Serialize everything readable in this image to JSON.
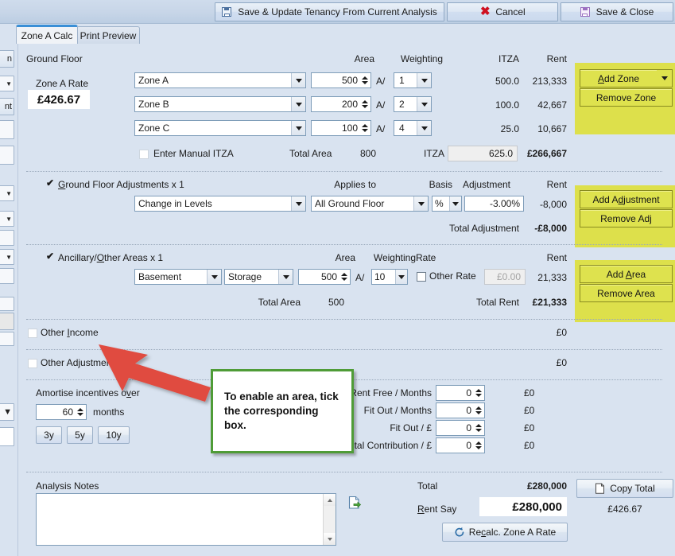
{
  "toolbar": {
    "save_update_label": "Save & Update Tenancy From Current Analysis",
    "cancel_label": "Cancel",
    "save_close_label": "Save & Close",
    "save_icon": "floppy-disk-icon",
    "cancel_icon": "red-x-icon"
  },
  "tabs": [
    {
      "label": "Zone A Calc",
      "active": true
    },
    {
      "label": "Print Preview",
      "active": false
    }
  ],
  "left_strip": {
    "stub_top_label": "n",
    "stub_mid_label": "nt"
  },
  "ground_floor": {
    "title": "Ground Floor",
    "zone_a_rate_label": "Zone A Rate",
    "zone_a_rate_value": "£426.67",
    "headers": {
      "area": "Area",
      "weighting": "Weighting",
      "itza": "ITZA",
      "rent": "Rent"
    },
    "rows": [
      {
        "zone": "Zone A",
        "area": "500",
        "weight_prefix": "A/",
        "weight": "1",
        "itza": "500.0",
        "rent": "213,333"
      },
      {
        "zone": "Zone B",
        "area": "200",
        "weight_prefix": "A/",
        "weight": "2",
        "itza": "100.0",
        "rent": "42,667"
      },
      {
        "zone": "Zone C",
        "area": "100",
        "weight_prefix": "A/",
        "weight": "4",
        "itza": "25.0",
        "rent": "10,667"
      }
    ],
    "manual_itza_label": "Enter Manual ITZA",
    "manual_itza_checked": false,
    "total_area_label": "Total Area",
    "total_area_value": "800",
    "itza_label": "ITZA",
    "itza_total": "625.0",
    "rent_total": "£266,667",
    "add_zone_label": "Add Zone",
    "remove_zone_label": "Remove Zone"
  },
  "adjustments": {
    "title": "Ground Floor Adjustments x 1",
    "checked": true,
    "headers": {
      "applies_to": "Applies to",
      "basis": "Basis",
      "adjustment": "Adjustment",
      "rent": "Rent"
    },
    "rows": [
      {
        "type": "Change in Levels",
        "applies_to": "All Ground Floor",
        "basis": "%",
        "adjustment": "-3.00%",
        "rent": "-8,000"
      }
    ],
    "total_label": "Total Adjustment",
    "total_value": "-£8,000",
    "add_label": "Add Adjustment",
    "remove_label": "Remove Adj"
  },
  "ancillary": {
    "title": "Ancillary/Other Areas x 1",
    "checked": true,
    "headers": {
      "area": "Area",
      "weighting": "Weighting",
      "rate": "Rate",
      "rent": "Rent"
    },
    "rows": [
      {
        "location": "Basement",
        "use": "Storage",
        "area": "500",
        "weight_prefix": "A/",
        "weight": "10",
        "other_rate_label": "Other Rate",
        "other_rate_checked": false,
        "rate_value": "£0.00",
        "rent": "21,333"
      }
    ],
    "total_area_label": "Total Area",
    "total_area_value": "500",
    "total_rent_label": "Total Rent",
    "total_rent_value": "£21,333",
    "add_label": "Add Area",
    "remove_label": "Remove Area"
  },
  "other_income": {
    "label": "Other Income",
    "checked": false,
    "value": "£0"
  },
  "other_adjustments": {
    "label": "Other Adjustments",
    "checked": false,
    "value": "£0"
  },
  "incentives": {
    "amortise_label": "Amortise incentives over",
    "months_value": "60",
    "months_label": "months",
    "preset_3y": "3y",
    "preset_5y": "5y",
    "preset_10y": "10y",
    "rows": [
      {
        "label": "Rent Free / Months",
        "value": "0",
        "amount": "£0"
      },
      {
        "label": "Fit Out / Months",
        "value": "0",
        "amount": "£0"
      },
      {
        "label": "Fit Out / £",
        "value": "0",
        "amount": "£0"
      },
      {
        "label": "Capital Contribution / £",
        "value": "0",
        "amount": "£0"
      }
    ]
  },
  "notes": {
    "label": "Analysis Notes",
    "value": "",
    "export_icon": "document-export-icon"
  },
  "summary": {
    "total_label": "Total",
    "total_value": "£280,000",
    "rent_say_label": "Rent Say",
    "rent_say_value": "£280,000",
    "copy_total_label": "Copy Total",
    "copy_total_icon": "clipboard-icon",
    "zone_a_rate_display": "£426.67",
    "recalc_label": "Recalc. Zone A Rate",
    "recalc_icon": "refresh-icon"
  },
  "annotation": {
    "callout_text": "To enable an area, tick the corresponding box.",
    "arrow_color": "#e04b40",
    "callout_border_color": "#4f9c37"
  },
  "colors": {
    "background": "#d9e3f0",
    "highlight_yellow": "#dde04b",
    "accent_blue": "#3a8fd6"
  }
}
